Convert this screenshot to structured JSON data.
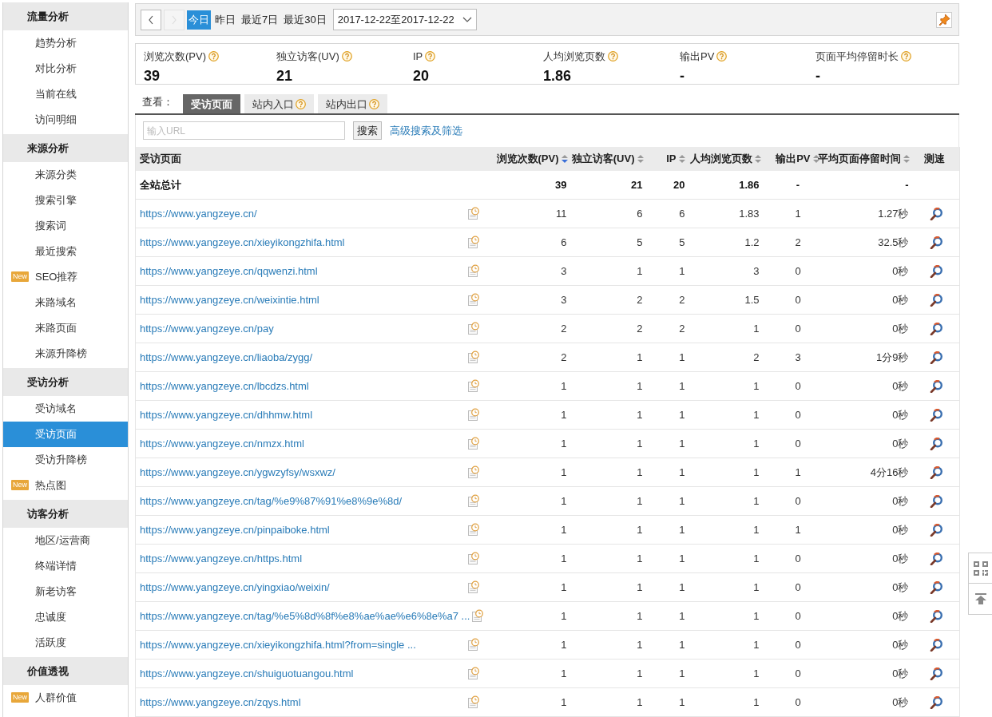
{
  "sidebar": {
    "groups": [
      {
        "title": "流量分析",
        "items": [
          {
            "label": "趋势分析",
            "selected": false
          },
          {
            "label": "对比分析",
            "selected": false
          },
          {
            "label": "当前在线",
            "selected": false
          },
          {
            "label": "访问明细",
            "selected": false
          }
        ]
      },
      {
        "title": "来源分析",
        "items": [
          {
            "label": "来源分类",
            "selected": false
          },
          {
            "label": "搜索引擎",
            "selected": false
          },
          {
            "label": "搜索词",
            "selected": false
          },
          {
            "label": "最近搜索",
            "selected": false
          },
          {
            "label": "SEO推荐",
            "selected": false,
            "badge": "New"
          },
          {
            "label": "来路域名",
            "selected": false
          },
          {
            "label": "来路页面",
            "selected": false
          },
          {
            "label": "来源升降榜",
            "selected": false
          }
        ]
      },
      {
        "title": "受访分析",
        "items": [
          {
            "label": "受访域名",
            "selected": false
          },
          {
            "label": "受访页面",
            "selected": true
          },
          {
            "label": "受访升降榜",
            "selected": false
          },
          {
            "label": "热点图",
            "selected": false,
            "badge": "New"
          }
        ]
      },
      {
        "title": "访客分析",
        "items": [
          {
            "label": "地区/运营商",
            "selected": false
          },
          {
            "label": "终端详情",
            "selected": false
          },
          {
            "label": "新老访客",
            "selected": false
          },
          {
            "label": "忠诚度",
            "selected": false
          },
          {
            "label": "活跃度",
            "selected": false
          }
        ]
      },
      {
        "title": "价值透视",
        "items": [
          {
            "label": "人群价值",
            "selected": false,
            "badge": "New"
          }
        ]
      }
    ]
  },
  "toolbar": {
    "nav": [
      {
        "kind": "prev",
        "disabled": false
      },
      {
        "kind": "next",
        "disabled": true
      }
    ],
    "ranges": [
      {
        "label": "今日",
        "selected": true
      },
      {
        "label": "昨日",
        "selected": false
      },
      {
        "label": "最近7日",
        "selected": false
      },
      {
        "label": "最近30日",
        "selected": false
      }
    ],
    "date_range": "2017-12-22至2017-12-22"
  },
  "metrics": [
    {
      "label": "浏览次数(PV)",
      "value": "39"
    },
    {
      "label": "独立访客(UV)",
      "value": "21"
    },
    {
      "label": "IP",
      "value": "20"
    },
    {
      "label": "人均浏览页数",
      "value": "1.86"
    },
    {
      "label": "输出PV",
      "value": "-"
    },
    {
      "label": "页面平均停留时长",
      "value": "-"
    }
  ],
  "view": {
    "label": "查看：",
    "tabs": [
      {
        "label": "受访页面",
        "selected": true,
        "help": false
      },
      {
        "label": "站内入口",
        "selected": false,
        "help": true
      },
      {
        "label": "站内出口",
        "selected": false,
        "help": true
      }
    ]
  },
  "search": {
    "placeholder": "输入URL",
    "button": "搜索",
    "advanced_link": "高级搜索及筛选"
  },
  "table": {
    "columns": [
      {
        "label": "受访页面"
      },
      {
        "label": "浏览次数(PV)",
        "sorted": true
      },
      {
        "label": "独立访客(UV)",
        "sorted": false
      },
      {
        "label": "IP",
        "sorted": false
      },
      {
        "label": "人均浏览页数",
        "sorted": false
      },
      {
        "label": "输出PV",
        "sorted": false
      },
      {
        "label": "平均页面停留时间",
        "sorted": false
      },
      {
        "label": "测速"
      }
    ],
    "total": {
      "label": "全站总计",
      "pv": "39",
      "uv": "21",
      "ip": "20",
      "pages_per_visitor": "1.86",
      "out_pv": "-",
      "avg_time": "-"
    },
    "rows": [
      {
        "url": "https://www.yangzeye.cn/",
        "pv": "11",
        "uv": "6",
        "ip": "6",
        "pages_per_visitor": "1.83",
        "out_pv": "1",
        "avg_time": "1.27秒"
      },
      {
        "url": "https://www.yangzeye.cn/xieyikongzhifa.html",
        "pv": "6",
        "uv": "5",
        "ip": "5",
        "pages_per_visitor": "1.2",
        "out_pv": "2",
        "avg_time": "32.5秒"
      },
      {
        "url": "https://www.yangzeye.cn/qqwenzi.html",
        "pv": "3",
        "uv": "1",
        "ip": "1",
        "pages_per_visitor": "3",
        "out_pv": "0",
        "avg_time": "0秒"
      },
      {
        "url": "https://www.yangzeye.cn/weixintie.html",
        "pv": "3",
        "uv": "2",
        "ip": "2",
        "pages_per_visitor": "1.5",
        "out_pv": "0",
        "avg_time": "0秒"
      },
      {
        "url": "https://www.yangzeye.cn/pay",
        "pv": "2",
        "uv": "2",
        "ip": "2",
        "pages_per_visitor": "1",
        "out_pv": "0",
        "avg_time": "0秒"
      },
      {
        "url": "https://www.yangzeye.cn/liaoba/zygg/",
        "pv": "2",
        "uv": "1",
        "ip": "1",
        "pages_per_visitor": "2",
        "out_pv": "3",
        "avg_time": "1分9秒"
      },
      {
        "url": "https://www.yangzeye.cn/lbcdzs.html",
        "pv": "1",
        "uv": "1",
        "ip": "1",
        "pages_per_visitor": "1",
        "out_pv": "0",
        "avg_time": "0秒"
      },
      {
        "url": "https://www.yangzeye.cn/dhhmw.html",
        "pv": "1",
        "uv": "1",
        "ip": "1",
        "pages_per_visitor": "1",
        "out_pv": "0",
        "avg_time": "0秒"
      },
      {
        "url": "https://www.yangzeye.cn/nmzx.html",
        "pv": "1",
        "uv": "1",
        "ip": "1",
        "pages_per_visitor": "1",
        "out_pv": "0",
        "avg_time": "0秒"
      },
      {
        "url": "https://www.yangzeye.cn/ygwzyfsy/wsxwz/",
        "pv": "1",
        "uv": "1",
        "ip": "1",
        "pages_per_visitor": "1",
        "out_pv": "1",
        "avg_time": "4分16秒"
      },
      {
        "url": "https://www.yangzeye.cn/tag/%e9%87%91%e8%9e%8d/",
        "pv": "1",
        "uv": "1",
        "ip": "1",
        "pages_per_visitor": "1",
        "out_pv": "0",
        "avg_time": "0秒"
      },
      {
        "url": "https://www.yangzeye.cn/pinpaiboke.html",
        "pv": "1",
        "uv": "1",
        "ip": "1",
        "pages_per_visitor": "1",
        "out_pv": "1",
        "avg_time": "0秒"
      },
      {
        "url": "https://www.yangzeye.cn/https.html",
        "pv": "1",
        "uv": "1",
        "ip": "1",
        "pages_per_visitor": "1",
        "out_pv": "0",
        "avg_time": "0秒"
      },
      {
        "url": "https://www.yangzeye.cn/yingxiao/weixin/",
        "pv": "1",
        "uv": "1",
        "ip": "1",
        "pages_per_visitor": "1",
        "out_pv": "0",
        "avg_time": "0秒"
      },
      {
        "url": "https://www.yangzeye.cn/tag/%e5%8d%8f%e8%ae%ae%e6%8e%a7 ...",
        "pv": "1",
        "uv": "1",
        "ip": "1",
        "pages_per_visitor": "1",
        "out_pv": "0",
        "avg_time": "0秒"
      },
      {
        "url": "https://www.yangzeye.cn/xieyikongzhifa.html?from=single ...",
        "pv": "1",
        "uv": "1",
        "ip": "1",
        "pages_per_visitor": "1",
        "out_pv": "0",
        "avg_time": "0秒"
      },
      {
        "url": "https://www.yangzeye.cn/shuiguotuangou.html",
        "pv": "1",
        "uv": "1",
        "ip": "1",
        "pages_per_visitor": "1",
        "out_pv": "0",
        "avg_time": "0秒"
      },
      {
        "url": "https://www.yangzeye.cn/zqys.html",
        "pv": "1",
        "uv": "1",
        "ip": "1",
        "pages_per_visitor": "1",
        "out_pv": "0",
        "avg_time": "0秒"
      }
    ]
  }
}
